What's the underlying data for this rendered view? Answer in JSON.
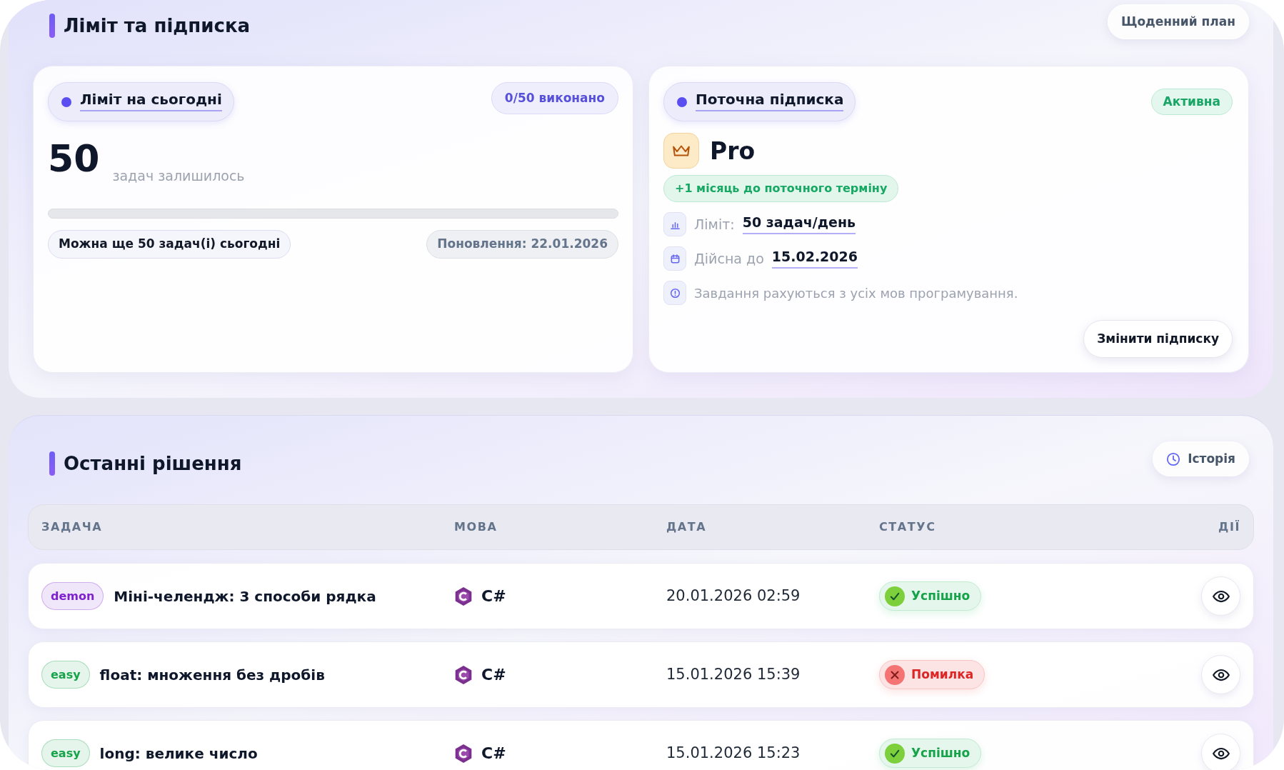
{
  "limits_section": {
    "title": "Ліміт та підписка",
    "daily_plan_button": "Щоденний план",
    "today_card": {
      "title": "Ліміт на сьогодні",
      "done_badge": "0/50 виконано",
      "remaining_count": "50",
      "remaining_label": "задач залишилось",
      "progress": {
        "level": 0
      },
      "can_do_note": "Можна ще 50 задач(і) сьогодні",
      "renewal": "Поновлення: 22.01.2026"
    },
    "subscription_card": {
      "title": "Поточна підписка",
      "status_badge": "Активна",
      "plan_name": "Pro",
      "extension_badge": "+1 місяць до поточного терміну",
      "details": [
        {
          "kind": "limit",
          "label": "Ліміт:",
          "value": "50 задач/день"
        },
        {
          "kind": "valid_until",
          "label": "Дійсна до",
          "value": "15.02.2026"
        },
        {
          "kind": "info",
          "text": "Завдання рахуються з усіх мов програмування."
        }
      ],
      "change_button": "Змінити підписку"
    }
  },
  "recent_section": {
    "title": "Останні рішення",
    "history_button": "Історія",
    "table": {
      "columns": [
        "ЗАДАЧА",
        "МОВА",
        "ДАТА",
        "СТАТУС",
        "ДІЇ"
      ],
      "rows": [
        {
          "difficulty": {
            "label": "demon",
            "color": "#7e22ce"
          },
          "task": "Міні-челендж: 3 способи рядка",
          "language": "C#",
          "date": "20.01.2026 02:59",
          "status": {
            "label": "Успішно",
            "kind": "success"
          }
        },
        {
          "difficulty": {
            "label": "easy",
            "color": "#16a34a"
          },
          "task": "float: множення без дробів",
          "language": "C#",
          "date": "15.01.2026 15:39",
          "status": {
            "label": "Помилка",
            "kind": "error"
          }
        },
        {
          "difficulty": {
            "label": "easy",
            "color": "#16a34a"
          },
          "task": "long: велике число",
          "language": "C#",
          "date": "15.01.2026 15:23",
          "status": {
            "label": "Успішно",
            "kind": "success"
          }
        }
      ]
    }
  }
}
